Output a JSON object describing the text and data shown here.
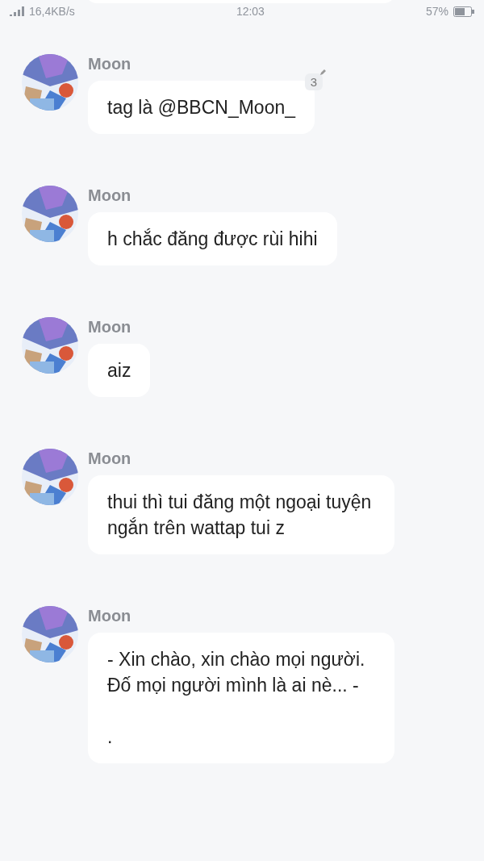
{
  "status_bar": {
    "network_speed": "16,4KB/s",
    "time": "12:03",
    "battery": "57%"
  },
  "messages": [
    {
      "sender": "Moon",
      "text": "tag là @BBCN_Moon_",
      "badge": "3"
    },
    {
      "sender": "Moon",
      "text": "h chắc đăng được rùi hihi"
    },
    {
      "sender": "Moon",
      "text": "aiz"
    },
    {
      "sender": "Moon",
      "text": "thui thì tui đăng một ngoại tuyện ngắn trên wattap tui z"
    },
    {
      "sender": "Moon",
      "text": "- Xin chào, xin chào mọi người. Đố mọi người mình là ai nè... -\n\n."
    }
  ]
}
